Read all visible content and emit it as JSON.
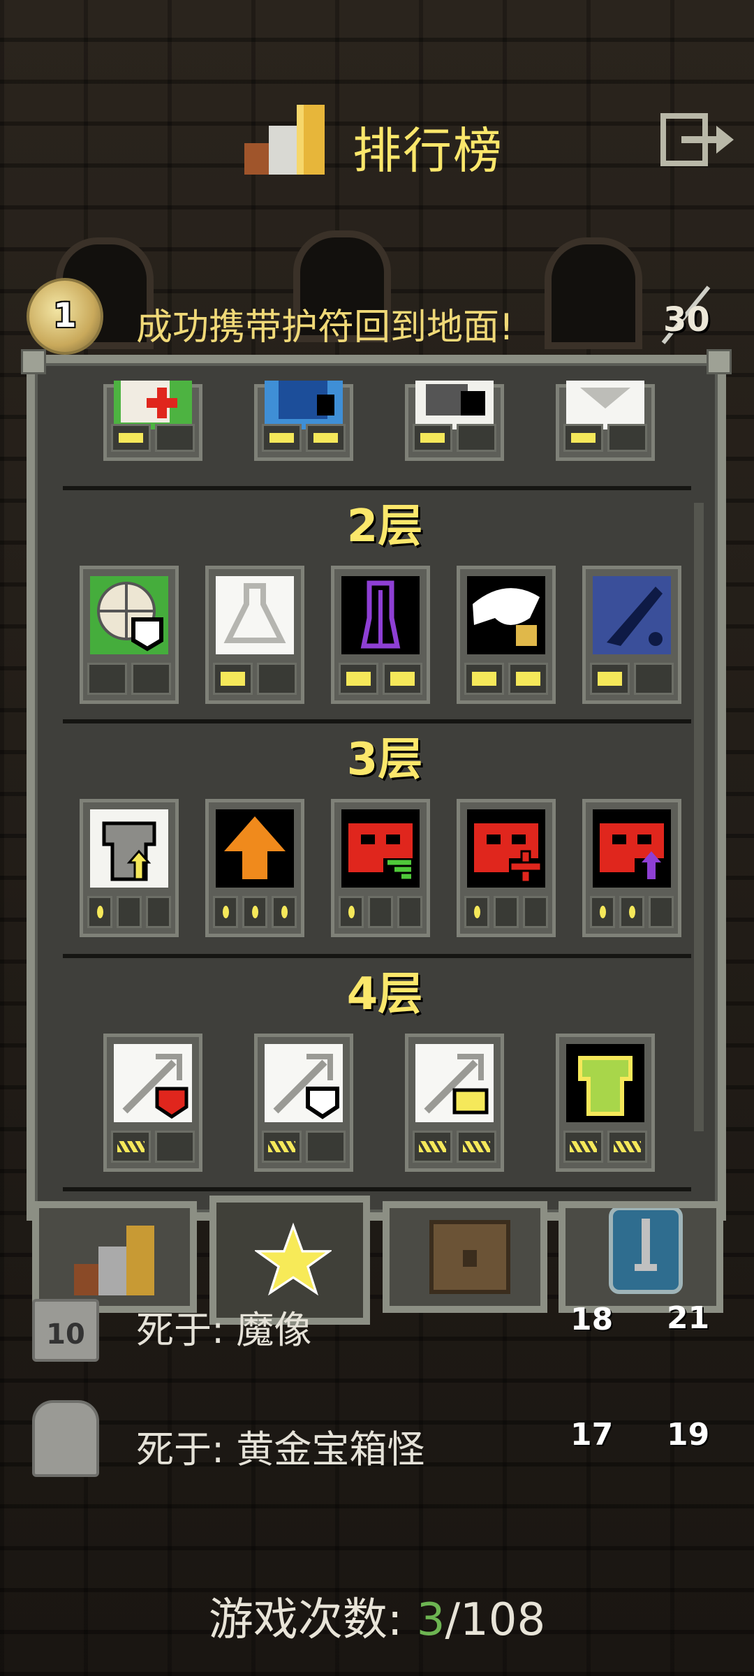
{
  "header": {
    "title": "排行榜"
  },
  "top_record": {
    "rank": "1",
    "text": "成功携带护符回到地面!",
    "score": "30"
  },
  "floors": [
    {
      "label": "2层"
    },
    {
      "label": "3层"
    },
    {
      "label": "4层"
    }
  ],
  "tabs": [
    {
      "name": "rankings-tab-icon"
    },
    {
      "name": "badges-tab-icon"
    },
    {
      "name": "journal-tab-icon"
    },
    {
      "name": "challenges-tab-icon"
    }
  ],
  "records": [
    {
      "rank": "10",
      "cause": "死于: 魔像",
      "depth": "18",
      "level": "21"
    },
    {
      "rank": "",
      "cause": "死于: 黄金宝箱怪",
      "depth": "17",
      "level": "19"
    }
  ],
  "footer": {
    "label": "游戏次数: ",
    "current": "3",
    "total": "/108"
  },
  "colors": {
    "accent": "#fbe76b",
    "panel": "#3f3f3b",
    "border": "#8c8f84",
    "count": "#6db552"
  }
}
